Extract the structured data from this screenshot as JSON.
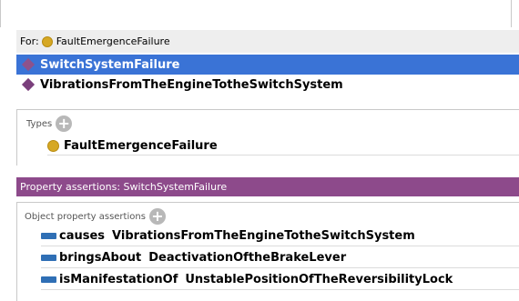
{
  "colors": {
    "selection": "#3a73d6",
    "individual_diamond": "#7a3f7c",
    "class_dot": "#d6a824",
    "property_header": "#8d4a8b",
    "object_property_icon": "#2f6fb5"
  },
  "individuals_panel": {
    "for_label": "For:",
    "for_class": "FaultEmergenceFailure",
    "for_icon": "class-circle-icon",
    "items": [
      {
        "label": "SwitchSystemFailure",
        "icon": "individual-diamond-icon",
        "selected": true
      },
      {
        "label": "VibrationsFromTheEngineTotheSwitchSystem",
        "icon": "individual-diamond-icon",
        "selected": false
      }
    ]
  },
  "types_section": {
    "header": "Types",
    "add_icon": "add-icon",
    "items": [
      {
        "label": "FaultEmergenceFailure",
        "icon": "class-circle-icon"
      }
    ]
  },
  "property_assertions": {
    "header": "Property assertions: SwitchSystemFailure",
    "object_section": {
      "header": "Object property assertions",
      "add_icon": "add-icon",
      "items": [
        {
          "property": "causes",
          "value": "VibrationsFromTheEngineTotheSwitchSystem",
          "icon": "object-property-icon"
        },
        {
          "property": "bringsAbout",
          "value": "DeactivationOftheBrakeLever",
          "icon": "object-property-icon"
        },
        {
          "property": "isManifestationOf",
          "value": "UnstablePositionOfTheReversibilityLock",
          "icon": "object-property-icon"
        }
      ]
    }
  }
}
